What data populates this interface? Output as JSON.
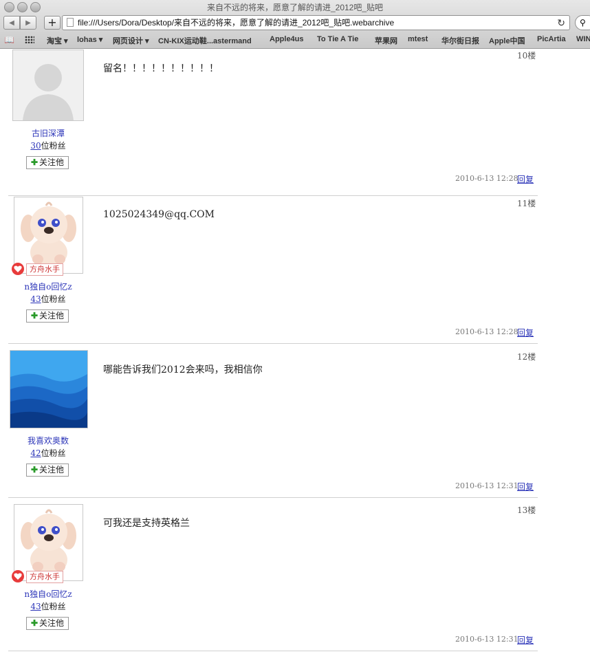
{
  "window": {
    "title": "来自不远的将来，愿意了解的请进_2012吧_贴吧"
  },
  "toolbar": {
    "url": "file:///Users/Dora/Desktop/来自不远的将来，愿意了解的请进_2012吧_贴吧.webarchive"
  },
  "bookmarks": [
    "淘宝 ▾",
    "lohas ▾",
    "网页设计 ▾",
    "CN-KIX运动鞋...astermand",
    "Apple4us",
    "To Tie A Tie",
    "苹果网",
    "mtest",
    "华尔街日报",
    "Apple中国",
    "PicArtia",
    "WIN"
  ],
  "posts": [
    {
      "floor": "10楼",
      "user": "古旧深潭",
      "fans_count": "30",
      "fans_suffix": "位粉丝",
      "follow": "关注他",
      "badge": "",
      "content": "留名！！！！！！！！！！",
      "time": "2010-6-13 12:28",
      "reply": "回复"
    },
    {
      "floor": "11楼",
      "user": "n独自o回忆z",
      "fans_count": "43",
      "fans_suffix": "位粉丝",
      "follow": "关注他",
      "badge": "方舟水手",
      "content": "1025024349@qq.COM",
      "time": "2010-6-13 12:28",
      "reply": "回复"
    },
    {
      "floor": "12楼",
      "user": "我喜欢奥数",
      "fans_count": "42",
      "fans_suffix": "位粉丝",
      "follow": "关注他",
      "badge": "",
      "content": "哪能告诉我们2012会来吗，我相信你",
      "time": "2010-6-13 12:31",
      "reply": "回复"
    },
    {
      "floor": "13楼",
      "user": "n独自o回忆z",
      "fans_count": "43",
      "fans_suffix": "位粉丝",
      "follow": "关注他",
      "badge": "方舟水手",
      "content": "可我还是支持英格兰",
      "time": "2010-6-13 12:31",
      "reply": "回复"
    }
  ]
}
